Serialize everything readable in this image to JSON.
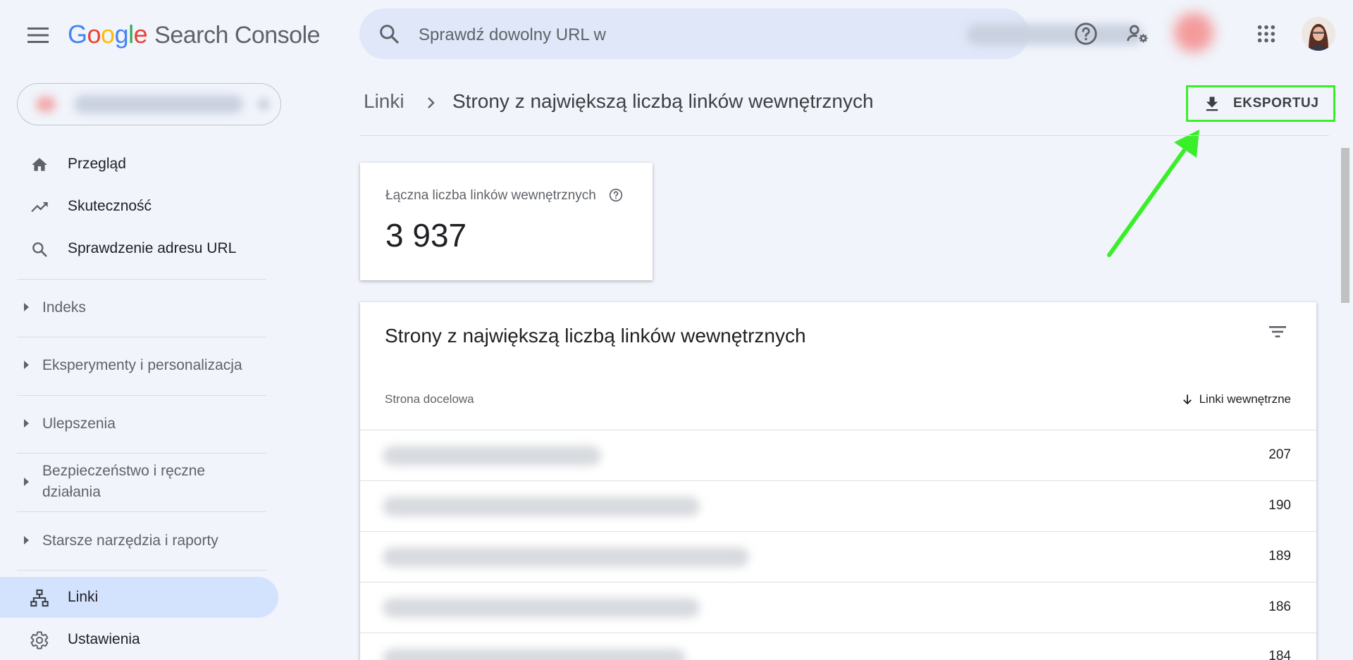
{
  "header": {
    "logo_letters": [
      "G",
      "o",
      "o",
      "g",
      "l",
      "e"
    ],
    "product": "Search Console",
    "search_placeholder": "Sprawdź dowolny URL w",
    "icons": [
      "menu-icon",
      "search-icon",
      "help-icon",
      "manage-users-icon",
      "apps-icon"
    ]
  },
  "sidebar": {
    "nav_top": [
      {
        "label": "Przegląd",
        "icon": "home-icon"
      },
      {
        "label": "Skuteczność",
        "icon": "trending-up-icon"
      },
      {
        "label": "Sprawdzenie adresu URL",
        "icon": "search-icon"
      }
    ],
    "sections": [
      {
        "label": "Indeks"
      },
      {
        "label": "Eksperymenty i personalizacja"
      },
      {
        "label": "Ulepszenia"
      },
      {
        "label": "Bezpieczeństwo i ręczne działania"
      },
      {
        "label": "Starsze narzędzia i raporty"
      }
    ],
    "nav_bottom": [
      {
        "label": "Linki",
        "icon": "sitemap-icon",
        "active": true
      },
      {
        "label": "Ustawienia",
        "icon": "gear-icon"
      }
    ]
  },
  "main": {
    "breadcrumb_parent": "Linki",
    "title": "Strony z największą liczbą linków wewnętrznych",
    "export_label": "EKSPORTUJ",
    "kpi": {
      "label": "Łączna liczba linków wewnętrznych",
      "value": "3 937"
    },
    "table": {
      "title": "Strony z największą liczbą linków wewnętrznych",
      "col_page": "Strona docelowa",
      "col_links": "Linki wewnętrzne",
      "rows": [
        {
          "value": "207"
        },
        {
          "value": "190"
        },
        {
          "value": "189"
        },
        {
          "value": "186"
        },
        {
          "value": "184"
        }
      ]
    }
  },
  "colors": {
    "accent_green": "#3aef2a",
    "active_nav": "#d3e3fd",
    "page_bg": "#f1f4fb"
  }
}
